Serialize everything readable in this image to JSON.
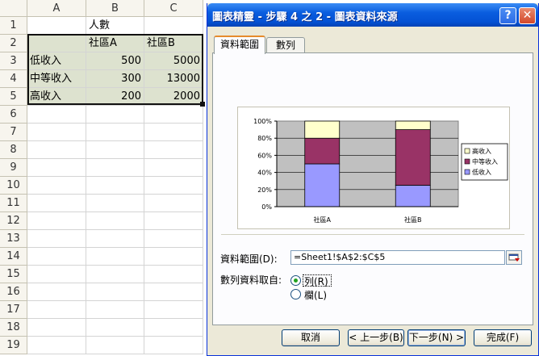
{
  "spreadsheet": {
    "columns": [
      "A",
      "B",
      "C"
    ],
    "rows": [
      "1",
      "2",
      "3",
      "4",
      "5",
      "6",
      "7",
      "8",
      "9",
      "10",
      "11",
      "12",
      "13",
      "14",
      "15",
      "16",
      "17",
      "18",
      "19"
    ],
    "cells": {
      "B1": "人數",
      "B2": "社區A",
      "C2": "社區B",
      "A3": "低收入",
      "B3": "500",
      "C3": "5000",
      "A4": "中等收入",
      "B4": "300",
      "C4": "13000",
      "A5": "高收入",
      "B5": "200",
      "C5": "2000"
    }
  },
  "dialog": {
    "title": "圖表精靈 - 步驟 4 之 2 - 圖表資料來源",
    "help_glyph": "?",
    "close_glyph": "✕",
    "tabs": [
      {
        "label": "資料範圍",
        "active": true
      },
      {
        "label": "數列",
        "active": false
      }
    ],
    "range_label": "資料範圍(D):",
    "range_value": "=Sheet1!$A$2:$C$5",
    "series_in_label": "數列資料取自:",
    "options": [
      {
        "label": "列(R)",
        "selected": true
      },
      {
        "label": "欄(L)",
        "selected": false
      }
    ],
    "buttons": {
      "cancel": "取消",
      "back": "< 上一步(B)",
      "next": "下一步(N) >",
      "finish": "完成(F)"
    }
  },
  "chart_data": {
    "type": "bar",
    "stacked": "percent",
    "categories": [
      "社區A",
      "社區B"
    ],
    "series": [
      {
        "name": "低收入",
        "values": [
          500,
          5000
        ],
        "color": "#9999ff"
      },
      {
        "name": "中等收入",
        "values": [
          300,
          13000
        ],
        "color": "#993366"
      },
      {
        "name": "高收入",
        "values": [
          200,
          2000
        ],
        "color": "#ffffcc"
      }
    ],
    "legend_order": [
      "高收入",
      "中等收入",
      "低收入"
    ],
    "y_ticks": [
      "0%",
      "20%",
      "40%",
      "60%",
      "80%",
      "100%"
    ],
    "ylim": [
      0,
      100
    ],
    "plot_background": "#c0c0c0",
    "grid": true,
    "legend_position": "right"
  }
}
